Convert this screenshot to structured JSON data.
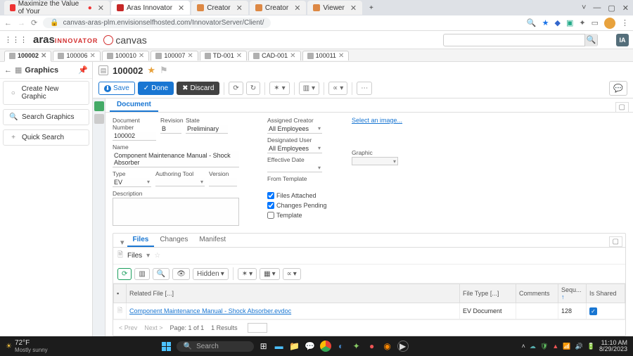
{
  "browser": {
    "tabs": [
      {
        "label": "Maximize the Value of Your",
        "favicon": "#e33"
      },
      {
        "label": "Aras Innovator",
        "favicon": "#c62828",
        "active": true
      },
      {
        "label": "Creator",
        "favicon": "#d84"
      },
      {
        "label": "Creator",
        "favicon": "#d84"
      },
      {
        "label": "Viewer",
        "favicon": "#d84"
      }
    ],
    "url": "canvas-aras-plm.envisionselfhosted.com/InnovatorServer/Client/",
    "win": {
      "min": "—",
      "max": "▢",
      "close": "✕"
    }
  },
  "app": {
    "logo1": "aras",
    "logo1sub": "INNOVATOR",
    "logo2": "canvas",
    "user_badge": "IA",
    "tabs": [
      {
        "label": "100002",
        "active": true
      },
      {
        "label": "100006"
      },
      {
        "label": "100010"
      },
      {
        "label": "100007"
      },
      {
        "label": "TD-001"
      },
      {
        "label": "CAD-001"
      },
      {
        "label": "100011"
      }
    ]
  },
  "sidebar": {
    "title": "Graphics",
    "items": [
      {
        "icon": "○",
        "label": "Create New Graphic"
      },
      {
        "icon": "🔍",
        "label": "Search Graphics"
      },
      {
        "icon": "+",
        "label": "Quick Search"
      }
    ]
  },
  "item": {
    "name": "100002",
    "toolbar": {
      "save": "Save",
      "done": "Done",
      "discard": "Discard"
    },
    "doc_tab": "Document",
    "form": {
      "doc_num_label": "Document Number",
      "doc_num": "100002",
      "rev_label": "Revision",
      "rev": "B",
      "state_label": "State",
      "state": "Preliminary",
      "name_label": "Name",
      "name": "Component Maintenance Manual - Shock Absorber",
      "type_label": "Type",
      "type": "EV",
      "auth_tool_label": "Authoring Tool",
      "auth_tool": "",
      "version_label": "Version",
      "version": "",
      "desc_label": "Description",
      "desc": "",
      "assigned_label": "Assigned Creator",
      "assigned": "All Employees",
      "designated_label": "Designated User",
      "designated": "All Employees",
      "eff_label": "Effective Date",
      "eff": "",
      "template_label": "From Template",
      "cb_files": "Files Attached",
      "cb_changes": "Changes Pending",
      "cb_template": "Template",
      "graphic_label": "Graphic",
      "select_image": "Select an image..."
    },
    "rel": {
      "tabs": [
        "Files",
        "Changes",
        "Manifest"
      ],
      "sub_title": "Files",
      "hidden": "Hidden",
      "cols": {
        "file": "Related File [...]",
        "type": "File Type [...]",
        "comments": "Comments",
        "seq": "Sequ...",
        "shared": "Is Shared"
      },
      "row": {
        "file": "Component Maintenance Manual - Shock Absorber.evdoc",
        "type": "EV Document",
        "seq": "128"
      },
      "pager": {
        "prev": "< Prev",
        "next": "Next >",
        "page": "Page: 1 of 1",
        "results": "1 Results"
      }
    }
  },
  "taskbar": {
    "temp": "72°F",
    "weather": "Mostly sunny",
    "search": "Search",
    "time": "11:10 AM",
    "date": "8/29/2023"
  }
}
